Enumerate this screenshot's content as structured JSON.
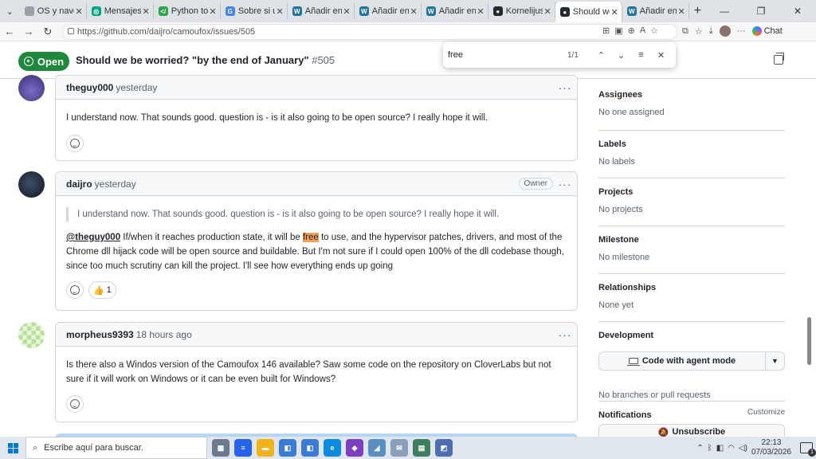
{
  "browser": {
    "tabs": [
      {
        "label": "OS y navegad",
        "fav_color": "#9aa0a6",
        "fav_glyph": ""
      },
      {
        "label": "Mensajes | W",
        "fav_color": "#00a884",
        "fav_glyph": "◎"
      },
      {
        "label": "Python to VB",
        "fav_color": "#2ea44f",
        "fav_glyph": "</"
      },
      {
        "label": "Sobre si un si",
        "fav_color": "#4285f4",
        "fav_glyph": "G"
      },
      {
        "label": "Añadir entrad",
        "fav_color": "#21759b",
        "fav_glyph": "W"
      },
      {
        "label": "Añadir entrad",
        "fav_color": "#21759b",
        "fav_glyph": "W"
      },
      {
        "label": "Añadir entrad",
        "fav_color": "#21759b",
        "fav_glyph": "W"
      },
      {
        "label": "Kornelijus/cal",
        "fav_color": "#24292f",
        "fav_glyph": "●"
      },
      {
        "label": "Should we be",
        "fav_color": "#24292f",
        "fav_glyph": "●",
        "active": true
      },
      {
        "label": "Añadir entrad",
        "fav_color": "#21759b",
        "fav_glyph": "W"
      }
    ],
    "url": "https://github.com/daijro/camoufox/issues/505",
    "chat_label": "Chat"
  },
  "findbar": {
    "query": "free",
    "count": "1/1"
  },
  "issue": {
    "status": "Open",
    "title": "Should we be worried? \"by the end of January\"",
    "number": "#505"
  },
  "comments": [
    {
      "user": "theguy000",
      "when": "yesterday",
      "body": "I understand now. That sounds good. question is - is it also going to be open source? I really hope it will."
    },
    {
      "user": "daijro",
      "when": "yesterday",
      "badge": "Owner",
      "quote": "I understand now. That sounds good. question is - is it also going to be open source? I really hope it will.",
      "mention": "@theguy000",
      "body_pre": " If/when it reaches production state, it will be ",
      "highlight": "free",
      "body_post": " to use, and the hypervisor patches, drivers, and most of the Chrome dll hijack code will be open source and buildable. But I'm not sure if I could open 100% of the dll codebase though, since too much scrutiny can kill the project. I'll see how everything ends up going",
      "reaction_emoji": "👍",
      "reaction_count": "1"
    },
    {
      "user": "morpheus9393",
      "when": "18 hours ago",
      "body": "Is there also a Windos version of the Camoufox 146 available? Saw some code on the repository on CloverLabs but not sure if it will work on Windows or it can be even built for Windows?"
    }
  ],
  "sidebar": {
    "sections": [
      {
        "title": "Assignees",
        "value": "No one assigned"
      },
      {
        "title": "Labels",
        "value": "No labels"
      },
      {
        "title": "Projects",
        "value": "No projects"
      },
      {
        "title": "Milestone",
        "value": "No milestone"
      },
      {
        "title": "Relationships",
        "value": "None yet"
      },
      {
        "title": "Development",
        "value": ""
      }
    ],
    "agent_button": "Code with agent mode",
    "dev_value": "No branches or pull requests",
    "notifications_title": "Notifications",
    "customize": "Customize",
    "unsubscribe": "Unsubscribe"
  },
  "taskbar": {
    "search_placeholder": "Escribe aquí para buscar.",
    "time": "22:13",
    "date": "07/03/2026",
    "notif_count": "1"
  }
}
